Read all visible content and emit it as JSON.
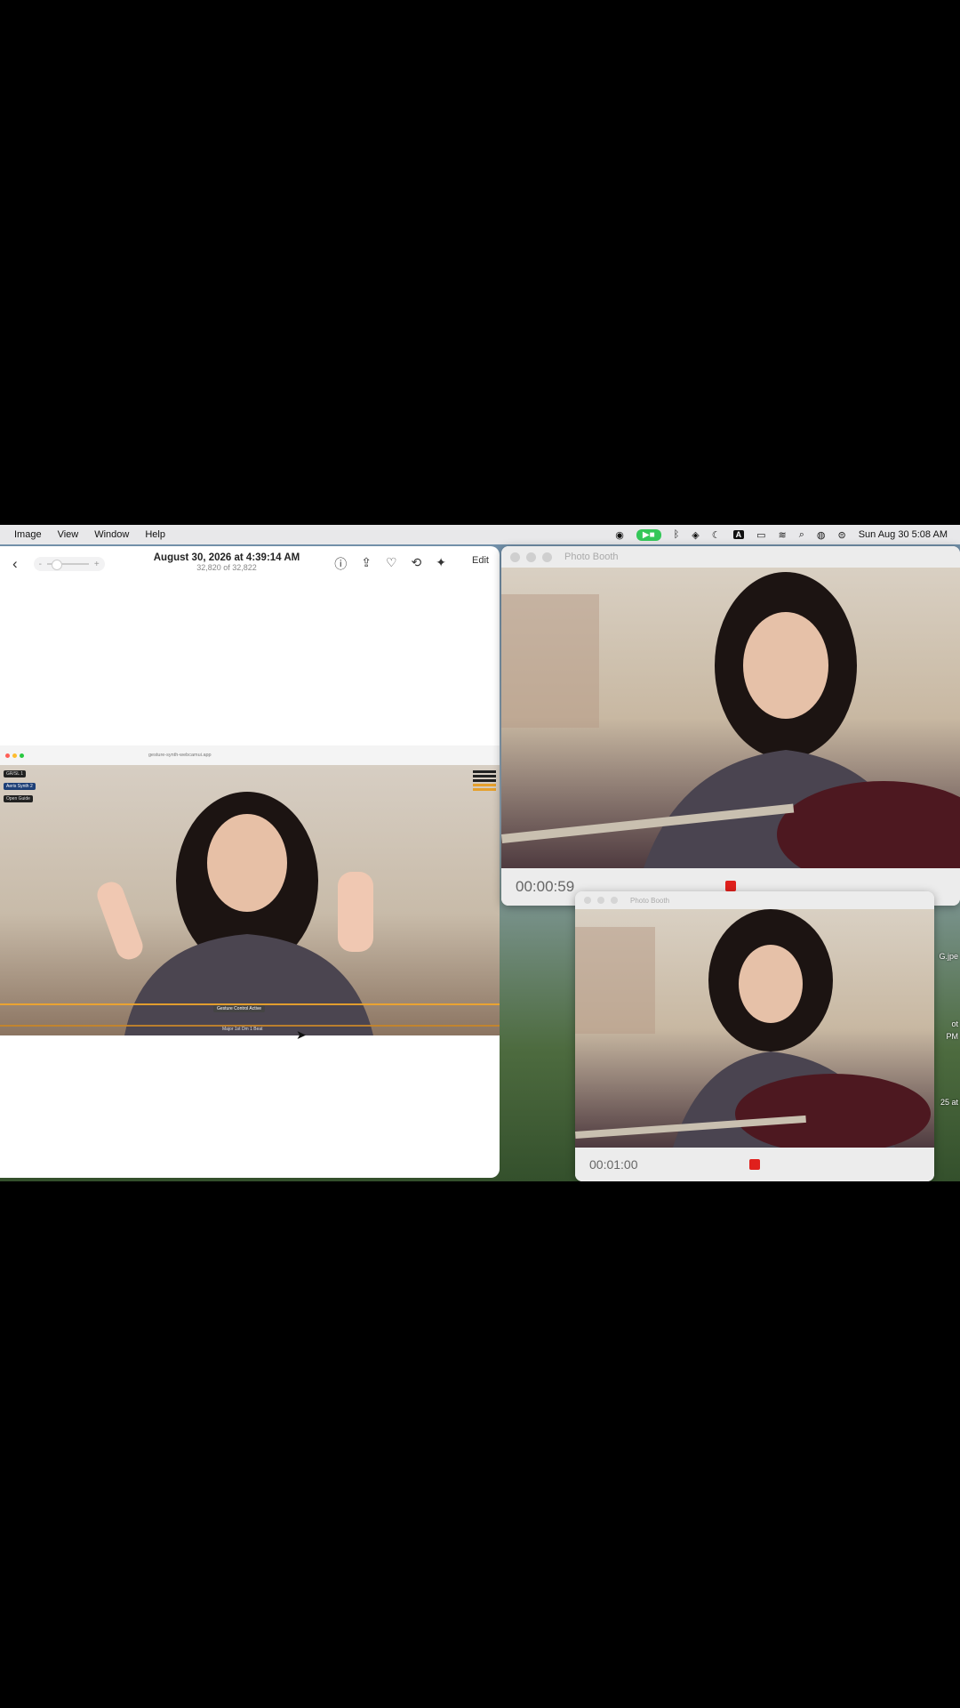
{
  "menubar": {
    "menus": [
      "Image",
      "View",
      "Window",
      "Help"
    ],
    "status_icons": [
      "record-icon",
      "facetime-icon",
      "bluetooth-icon",
      "vpn-icon",
      "moon-icon",
      "input-source-icon",
      "battery-icon",
      "wifi-icon",
      "search-icon",
      "siri-icon",
      "control-center-icon"
    ],
    "input_source": "A",
    "clock": "Sun Aug 30  5:08 AM"
  },
  "photos": {
    "title": "August 30, 2026 at 4:39:14 AM",
    "subtitle": "32,820 of 32,822",
    "zoom_minus": "-",
    "zoom_plus": "+",
    "edit_label": "Edit",
    "tool_icons": [
      "info-icon",
      "share-icon",
      "heart-icon",
      "rotate-icon",
      "enhance-icon"
    ]
  },
  "screenshot": {
    "url": "gesture-synth-webcamui.app",
    "chip_1": "GR/SL 1",
    "chip_2": "Aeris Synth  2",
    "chip_3": "Open Guide",
    "caption": "Gesture Control Active",
    "caption2": "Major 1st Dm  1 Beat"
  },
  "booth_main": {
    "title": "Photo Booth",
    "timer": "00:00:59"
  },
  "booth_small": {
    "title": "Photo Booth",
    "timer": "00:01:00"
  },
  "desktop_labels": [
    "G.jpe",
    "ot",
    "PM",
    "25 at"
  ],
  "colors": {
    "facetime_green": "#34c759",
    "record_red": "#e0201c",
    "wave_orange": "#f2a72b"
  }
}
